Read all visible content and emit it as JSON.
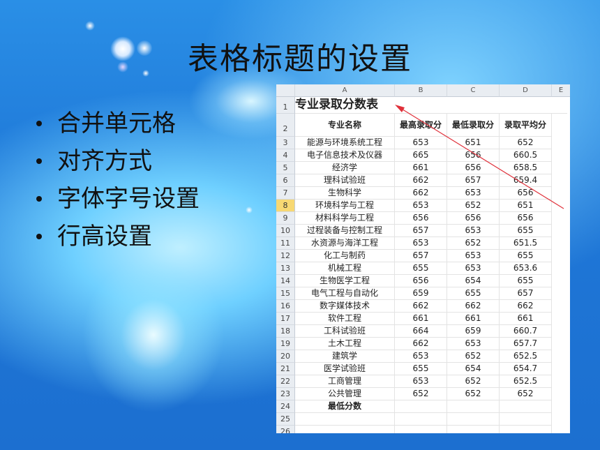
{
  "slide": {
    "title": "表格标题的设置",
    "bullets": [
      "合并单元格",
      "对齐方式",
      "字体字号设置",
      "行高设置"
    ]
  },
  "sheet": {
    "columns": [
      "A",
      "B",
      "C",
      "D",
      "E"
    ],
    "title_cell": "专业录取分数表",
    "headers": [
      "专业名称",
      "最高录取分",
      "最低录取分",
      "录取平均分"
    ],
    "selected_row": "8",
    "rows": [
      {
        "num": "3",
        "name": "能源与环境系统工程",
        "max": "653",
        "min": "651",
        "avg": "652"
      },
      {
        "num": "4",
        "name": "电子信息技术及仪器",
        "max": "665",
        "min": "656",
        "avg": "660.5"
      },
      {
        "num": "5",
        "name": "经济学",
        "max": "661",
        "min": "656",
        "avg": "658.5"
      },
      {
        "num": "6",
        "name": "理科试验班",
        "max": "662",
        "min": "657",
        "avg": "659.4"
      },
      {
        "num": "7",
        "name": "生物科学",
        "max": "662",
        "min": "653",
        "avg": "656"
      },
      {
        "num": "8",
        "name": "环境科学与工程",
        "max": "653",
        "min": "652",
        "avg": "651"
      },
      {
        "num": "9",
        "name": "材料科学与工程",
        "max": "656",
        "min": "656",
        "avg": "656"
      },
      {
        "num": "10",
        "name": "过程装备与控制工程",
        "max": "657",
        "min": "653",
        "avg": "655"
      },
      {
        "num": "11",
        "name": "水资源与海洋工程",
        "max": "653",
        "min": "652",
        "avg": "651.5"
      },
      {
        "num": "12",
        "name": "化工与制药",
        "max": "657",
        "min": "653",
        "avg": "655"
      },
      {
        "num": "13",
        "name": "机械工程",
        "max": "655",
        "min": "653",
        "avg": "653.6"
      },
      {
        "num": "14",
        "name": "生物医学工程",
        "max": "656",
        "min": "654",
        "avg": "655"
      },
      {
        "num": "15",
        "name": "电气工程与自动化",
        "max": "659",
        "min": "655",
        "avg": "657"
      },
      {
        "num": "16",
        "name": "数字媒体技术",
        "max": "662",
        "min": "662",
        "avg": "662"
      },
      {
        "num": "17",
        "name": "软件工程",
        "max": "661",
        "min": "661",
        "avg": "661"
      },
      {
        "num": "18",
        "name": "工科试验班",
        "max": "664",
        "min": "659",
        "avg": "660.7"
      },
      {
        "num": "19",
        "name": "土木工程",
        "max": "662",
        "min": "653",
        "avg": "657.7"
      },
      {
        "num": "20",
        "name": "建筑学",
        "max": "653",
        "min": "652",
        "avg": "652.5"
      },
      {
        "num": "21",
        "name": "医学试验班",
        "max": "655",
        "min": "654",
        "avg": "654.7"
      },
      {
        "num": "22",
        "name": "工商管理",
        "max": "653",
        "min": "652",
        "avg": "652.5"
      },
      {
        "num": "23",
        "name": "公共管理",
        "max": "652",
        "min": "652",
        "avg": "652"
      },
      {
        "num": "24",
        "name": "最低分数",
        "max": "",
        "min": "",
        "avg": ""
      },
      {
        "num": "25",
        "name": "",
        "max": "",
        "min": "",
        "avg": ""
      },
      {
        "num": "26",
        "name": "",
        "max": "",
        "min": "",
        "avg": ""
      }
    ],
    "row_numbers_top": [
      "1",
      "2"
    ]
  },
  "colors": {
    "accent_arrow": "#e0303a",
    "selected_row": "#f7d873",
    "background": "#1f78d8"
  }
}
